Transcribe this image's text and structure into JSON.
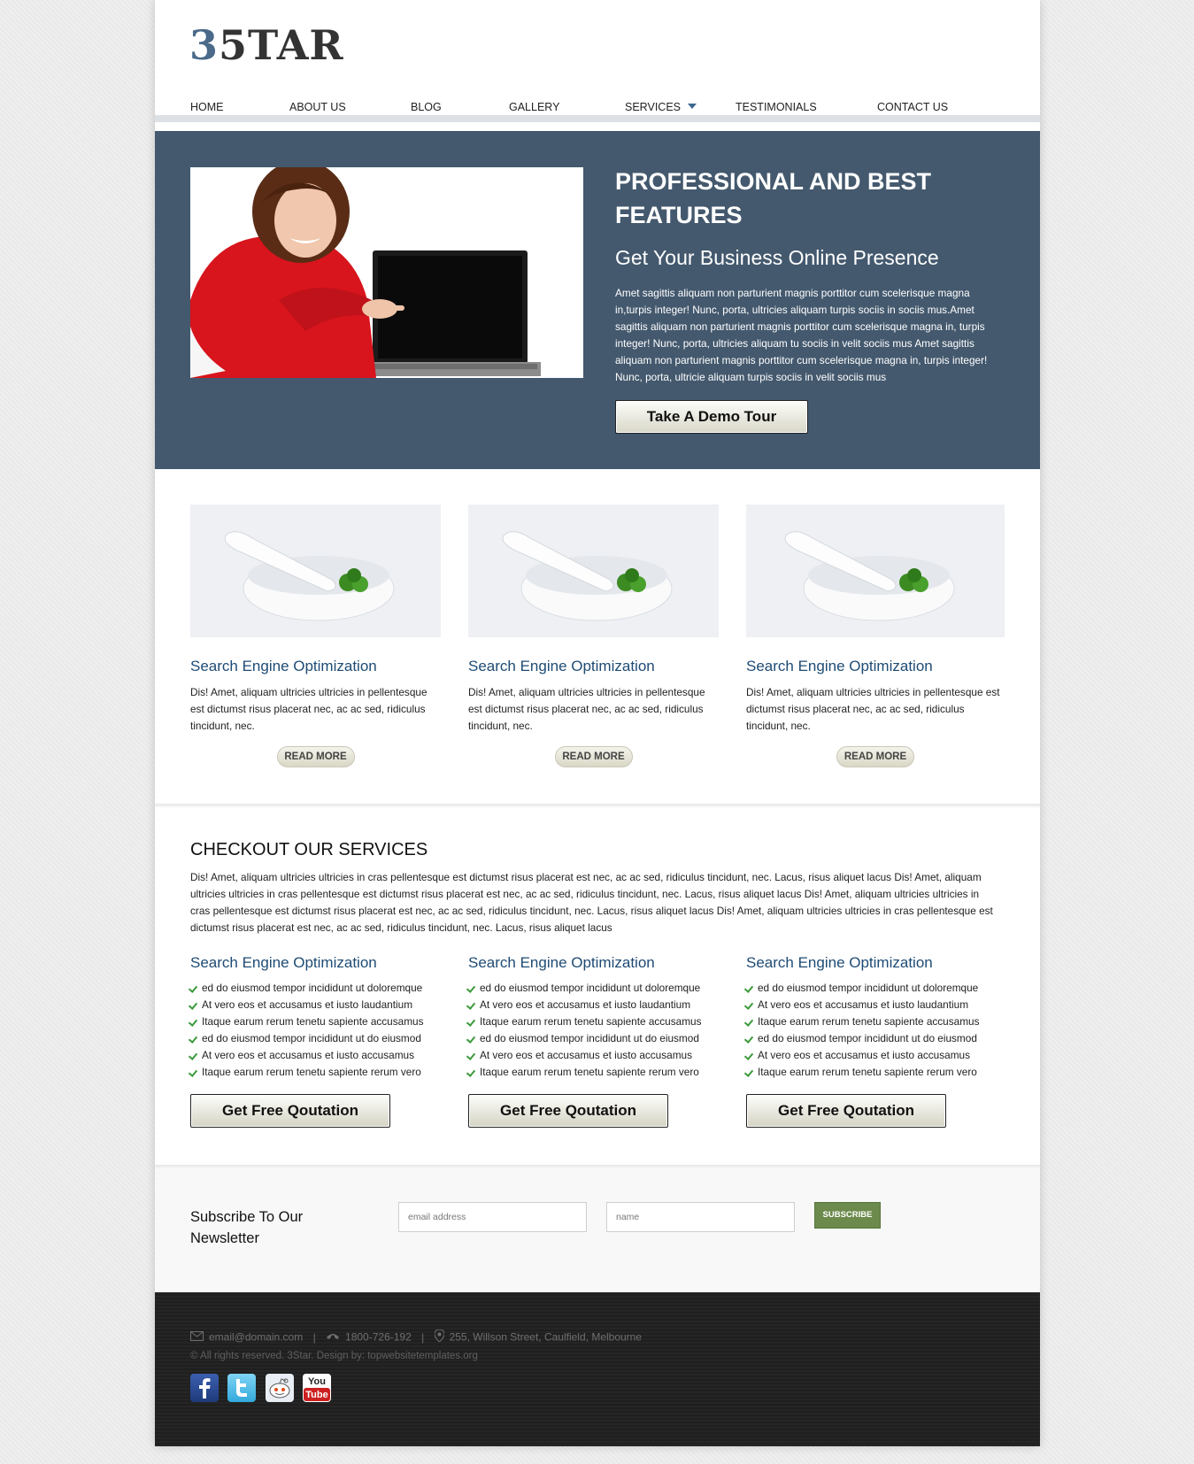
{
  "header": {
    "logo_num": "3",
    "logo_text": "5TAR",
    "nav": [
      "HOME",
      "ABOUT US",
      "BLOG",
      "GALLERY",
      "SERVICES",
      "TESTIMONIALS",
      "CONTACT US"
    ]
  },
  "hero": {
    "title": "PROFESSIONAL AND BEST FEATURES",
    "subtitle": "Get Your Business Online Presence",
    "text": "Amet sagittis aliquam non parturient magnis porttitor cum scelerisque magna in,turpis integer! Nunc, porta, ultricies aliquam turpis sociis in sociis mus.Amet sagittis aliquam non parturient magnis porttitor cum scelerisque magna in, turpis integer! Nunc, porta, ultricies aliquam tu sociis in velit sociis mus Amet sagittis aliquam non parturient magnis porttitor cum scelerisque magna in, turpis integer! Nunc, porta, ultricie aliquam turpis sociis in velit sociis mus",
    "button": "Take A Demo Tour"
  },
  "features": [
    {
      "title": "Search Engine Optimization",
      "text": "Dis! Amet, aliquam ultricies ultricies in pellentesque est dictumst risus placerat nec, ac ac sed, ridiculus tincidunt, nec.",
      "button": "READ MORE"
    },
    {
      "title": "Search Engine Optimization",
      "text": "Dis! Amet, aliquam ultricies ultricies in pellentesque est dictumst risus placerat nec, ac ac sed, ridiculus tincidunt, nec.",
      "button": "READ MORE"
    },
    {
      "title": "Search Engine Optimization",
      "text": "Dis! Amet, aliquam ultricies ultricies in pellentesque est dictumst risus placerat nec, ac ac sed, ridiculus tincidunt, nec.",
      "button": "READ MORE"
    }
  ],
  "services": {
    "title": "CHECKOUT OUR SERVICES",
    "text": "Dis! Amet, aliquam ultricies ultricies in cras pellentesque est dictumst risus placerat est nec, ac ac sed, ridiculus tincidunt, nec. Lacus, risus aliquet lacus Dis! Amet, aliquam ultricies ultricies in cras pellentesque est dictumst risus placerat est nec, ac ac sed, ridiculus tincidunt, nec. Lacus, risus aliquet lacus Dis! Amet, aliquam ultricies ultricies in cras pellentesque est dictumst risus placerat est nec, ac ac sed, ridiculus tincidunt, nec. Lacus, risus aliquet lacus Dis! Amet, aliquam ultricies ultricies in cras pellentesque est dictumst risus placerat est nec, ac ac sed, ridiculus tincidunt, nec. Lacus, risus aliquet lacus",
    "columns": [
      {
        "title": "Search Engine Optimization",
        "items": [
          "ed do eiusmod tempor incididunt ut doloremque",
          "At vero eos et accusamus et iusto laudantium",
          "Itaque earum rerum tenetu sapiente accusamus",
          "ed do eiusmod tempor incididunt ut do eiusmod",
          "At vero eos et accusamus et iusto accusamus",
          "Itaque earum rerum tenetu sapiente rerum vero"
        ],
        "button": "Get Free Qoutation"
      },
      {
        "title": "Search Engine Optimization",
        "items": [
          "ed do eiusmod tempor incididunt ut doloremque",
          "At vero eos et accusamus et iusto laudantium",
          "Itaque earum rerum tenetu sapiente accusamus",
          "ed do eiusmod tempor incididunt ut do eiusmod",
          "At vero eos et accusamus et iusto accusamus",
          "Itaque earum rerum tenetu sapiente rerum vero"
        ],
        "button": "Get Free Qoutation"
      },
      {
        "title": "Search Engine Optimization",
        "items": [
          "ed do eiusmod tempor incididunt ut doloremque",
          "At vero eos et accusamus et iusto laudantium",
          "Itaque earum rerum tenetu sapiente accusamus",
          "ed do eiusmod tempor incididunt ut do eiusmod",
          "At vero eos et accusamus et iusto accusamus",
          "Itaque earum rerum tenetu sapiente rerum vero"
        ],
        "button": "Get Free Qoutation"
      }
    ]
  },
  "newsletter": {
    "title": "Subscribe To Our Newsletter",
    "email_placeholder": "email address",
    "name_placeholder": "name",
    "button": "SUBSCRIBE"
  },
  "footer": {
    "email": "email@domain.com",
    "phone": "1800-726-192",
    "address": "255, Willson Street, Caulfield, Melbourne",
    "separator": "|",
    "copyright": "© All rights reserved. 3Star. Design by: topwebsitetemplates.org",
    "socials": [
      "facebook-icon",
      "twitter-icon",
      "reddit-icon",
      "youtube-icon"
    ],
    "youtube_top": "You",
    "youtube_bottom": "Tube"
  },
  "colors": {
    "hero_bg": "#44596e",
    "accent_blue": "#1e4b74",
    "subscribe_green": "#6c8a4c",
    "footer_bg": "#222222"
  }
}
